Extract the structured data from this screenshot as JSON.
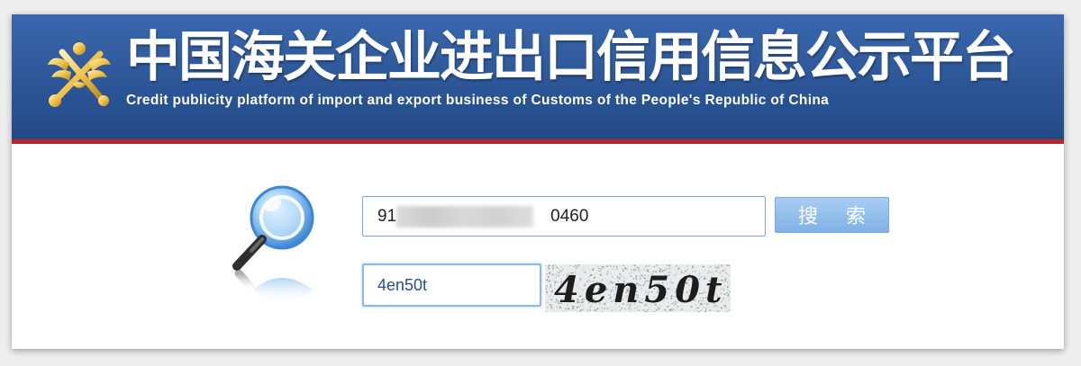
{
  "header": {
    "title_cn": "中国海关企业进出口信用信息公示平台",
    "title_en": "Credit publicity platform of import and export business of Customs of the People's Republic of China",
    "banner_color": "#2c5697",
    "rule_color": "#b8272b"
  },
  "search": {
    "query": "910460",
    "query_prefix": "91",
    "query_suffix": "0460",
    "button_label": "搜 索"
  },
  "captcha": {
    "input_value": "4en50t",
    "image_text": "4en50t"
  },
  "icons": {
    "emblem": "customs-emblem-icon",
    "magnifier": "magnifier-icon"
  }
}
